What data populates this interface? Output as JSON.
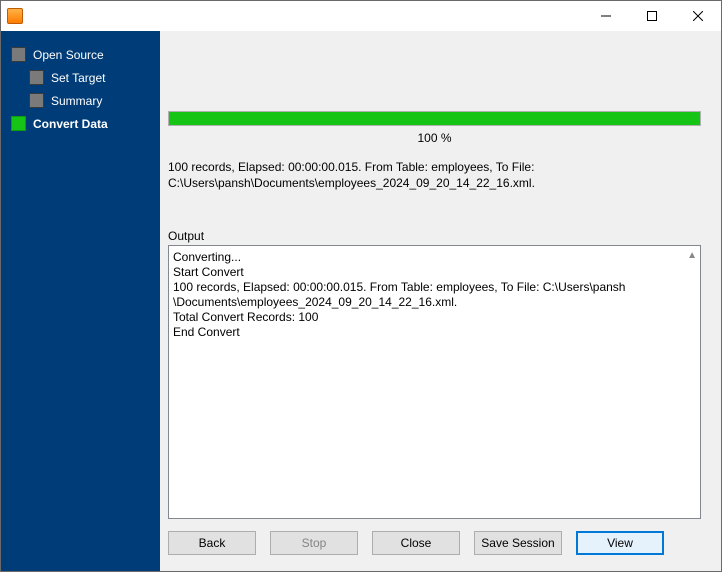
{
  "window": {
    "title": ""
  },
  "sidebar": {
    "items": [
      {
        "label": "Open Source",
        "current": false
      },
      {
        "label": "Set Target",
        "current": false
      },
      {
        "label": "Summary",
        "current": false
      },
      {
        "label": "Convert Data",
        "current": true
      }
    ]
  },
  "progress": {
    "percent_label": "100 %",
    "fill_percent": 100
  },
  "summary": {
    "line1": "100 records,    Elapsed: 00:00:00.015.    From Table: employees,    To File:",
    "line2": "C:\\Users\\pansh\\Documents\\employees_2024_09_20_14_22_16.xml."
  },
  "output": {
    "label": "Output",
    "lines": [
      "Converting...",
      "Start Convert",
      "100 records,    Elapsed: 00:00:00.015.    From Table: employees,    To File: C:\\Users\\pansh",
      "\\Documents\\employees_2024_09_20_14_22_16.xml.",
      "Total Convert Records: 100",
      "End Convert"
    ]
  },
  "buttons": {
    "back": "Back",
    "stop": "Stop",
    "close": "Close",
    "save_session": "Save Session",
    "view": "View"
  }
}
